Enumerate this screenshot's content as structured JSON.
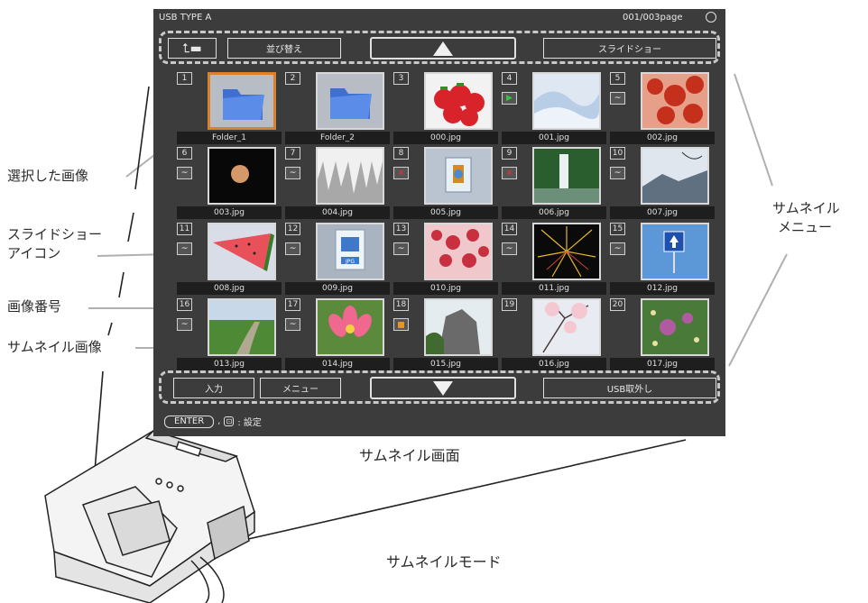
{
  "screen": {
    "source": "USB TYPE A",
    "page": "001/003page",
    "top_buttons": {
      "sort": "並び替え",
      "slideshow": "スライドショー"
    },
    "bottom_buttons": {
      "input": "入力",
      "menu": "メニュー",
      "usb_remove": "USB取外し"
    },
    "footer": {
      "enter": "ENTER",
      "action": ": 設定"
    },
    "thumbnails": [
      {
        "num": "1",
        "name": "Folder_1",
        "type": "folder",
        "icon": "",
        "selected": true
      },
      {
        "num": "2",
        "name": "Folder_2",
        "type": "folder",
        "icon": "",
        "selected": false
      },
      {
        "num": "3",
        "name": "000.jpg",
        "type": "strawberry",
        "icon": "",
        "selected": false
      },
      {
        "num": "4",
        "name": "001.jpg",
        "type": "snow",
        "icon": "play",
        "selected": false
      },
      {
        "num": "5",
        "name": "002.jpg",
        "type": "leaves",
        "icon": "~",
        "selected": false
      },
      {
        "num": "6",
        "name": "003.jpg",
        "type": "moon",
        "icon": "~",
        "selected": false
      },
      {
        "num": "7",
        "name": "004.jpg",
        "type": "icicle",
        "icon": "~",
        "selected": false
      },
      {
        "num": "8",
        "name": "005.jpg",
        "type": "error",
        "icon": "x",
        "selected": false
      },
      {
        "num": "9",
        "name": "006.jpg",
        "type": "waterfall",
        "icon": "x",
        "selected": false
      },
      {
        "num": "10",
        "name": "007.jpg",
        "type": "mountain",
        "icon": "~",
        "selected": false
      },
      {
        "num": "11",
        "name": "008.jpg",
        "type": "watermelon",
        "icon": "~",
        "selected": false
      },
      {
        "num": "12",
        "name": "009.jpg",
        "type": "jpgfile",
        "icon": "~",
        "selected": false
      },
      {
        "num": "13",
        "name": "010.jpg",
        "type": "blossom",
        "icon": "~",
        "selected": false
      },
      {
        "num": "14",
        "name": "011.jpg",
        "type": "fireworks",
        "icon": "~",
        "selected": false
      },
      {
        "num": "15",
        "name": "012.jpg",
        "type": "sign",
        "icon": "~",
        "selected": false
      },
      {
        "num": "16",
        "name": "013.jpg",
        "type": "road",
        "icon": "~",
        "selected": false
      },
      {
        "num": "17",
        "name": "014.jpg",
        "type": "lotus",
        "icon": "~",
        "selected": false
      },
      {
        "num": "18",
        "name": "015.jpg",
        "type": "rock",
        "icon": "stop",
        "selected": false
      },
      {
        "num": "19",
        "name": "016.jpg",
        "type": "sakura",
        "icon": "",
        "selected": false
      },
      {
        "num": "20",
        "name": "017.jpg",
        "type": "flowers",
        "icon": "",
        "selected": false
      }
    ]
  },
  "labels": {
    "selected_image": "選択した画像",
    "slideshow_icon_1": "スライドショー",
    "slideshow_icon_2": "アイコン",
    "image_number": "画像番号",
    "thumbnail_image": "サムネイル画像",
    "thumbnail_menu_1": "サムネイル",
    "thumbnail_menu_2": "メニュー",
    "thumbnail_screen": "サムネイル画面",
    "thumbnail_mode": "サムネイルモード"
  },
  "colors": {
    "screen_bg": "#3c3c3c",
    "selected_border": "#d9822b",
    "callout_line": "#b0b0b0"
  }
}
